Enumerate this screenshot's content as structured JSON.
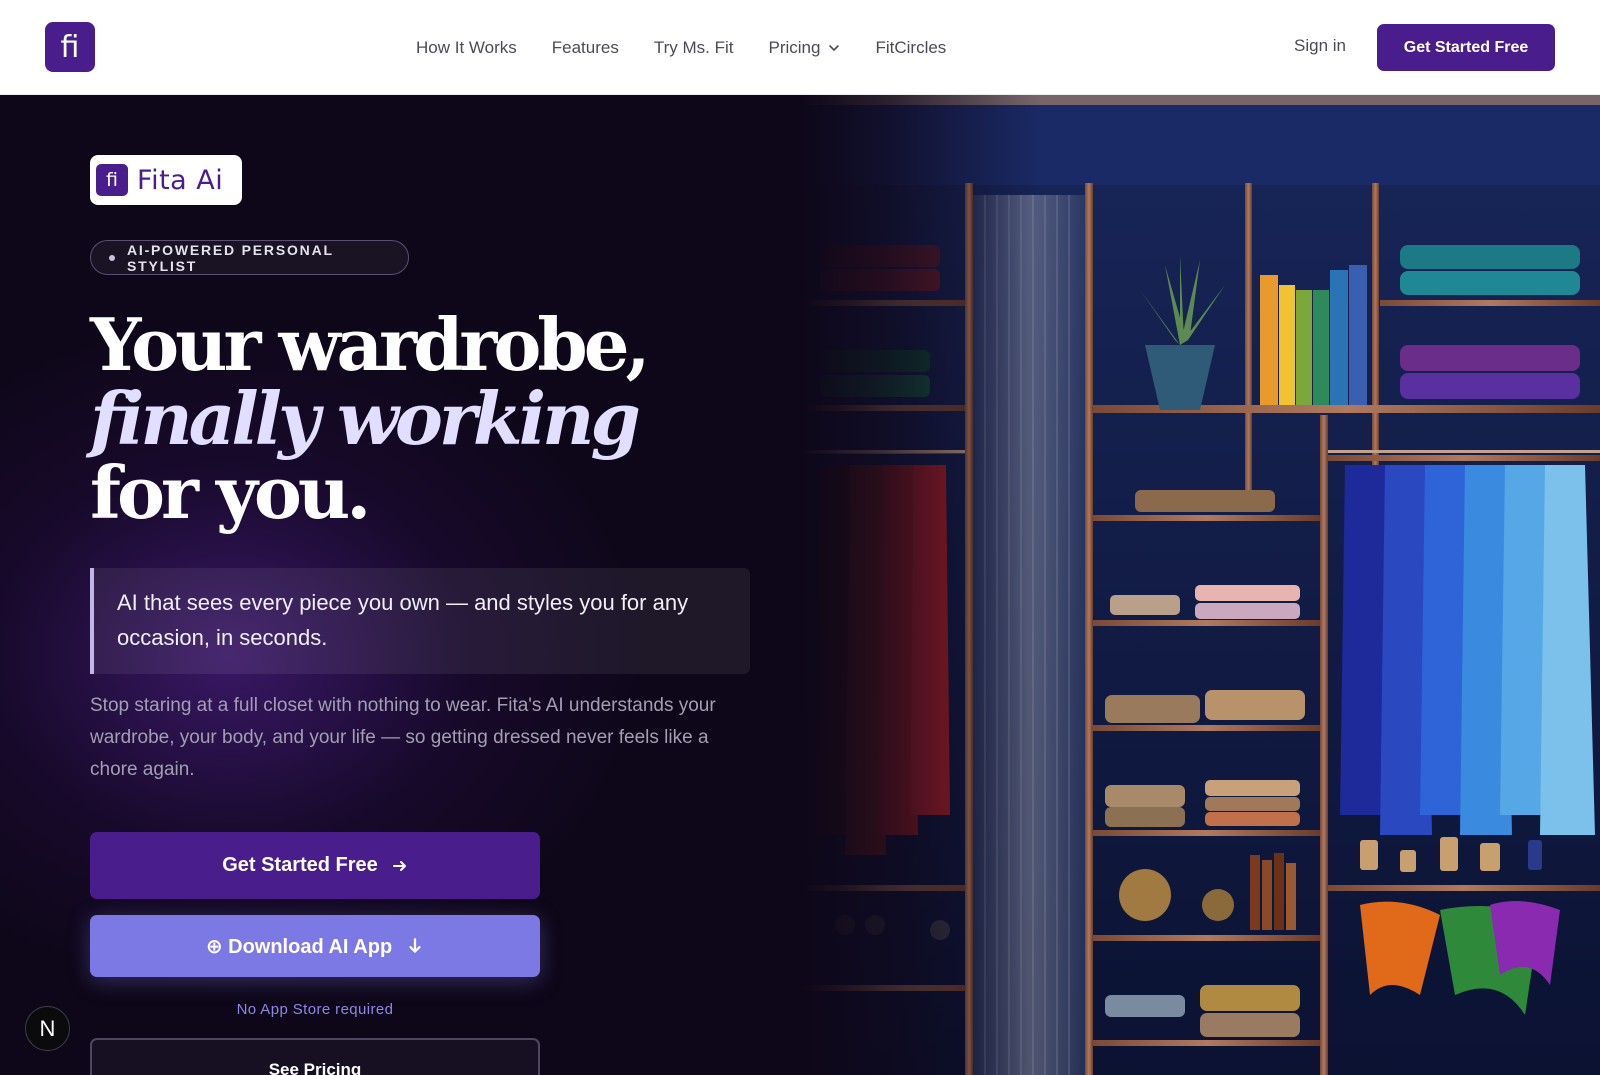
{
  "header": {
    "logo_glyph": "ﬁ",
    "nav": [
      {
        "label": "How It Works"
      },
      {
        "label": "Features"
      },
      {
        "label": "Try Ms. Fit"
      },
      {
        "label": "Pricing"
      },
      {
        "label": "FitCircles"
      }
    ],
    "signin_label": "Sign in",
    "cta_label": "Get Started Free"
  },
  "hero": {
    "brand_glyph": "ﬁ",
    "brand_name": "Fita Ai",
    "badge": "AI-POWERED PERSONAL STYLIST",
    "headline": {
      "line1": "Your wardrobe,",
      "line2": "finally working",
      "line3": "for you."
    },
    "quote": "AI that sees every piece you own — and styles you for any occasion, in seconds.",
    "paragraph": "Stop staring at a full closet with nothing to wear. Fita's AI understands your wardrobe, your body, and your life — so getting dressed never feels like a chore again.",
    "primary_cta": "Get Started Free",
    "download_cta": "⊕ Download AI App",
    "download_note": "No App Store required",
    "pricing_cta": "See Pricing"
  },
  "dev_badge": "N",
  "colors": {
    "brand": "#4a1d8c",
    "download": "#7c78e4",
    "hero_bg": "#0e0719",
    "note": "#8b86e8"
  },
  "icons": [
    "chevron-down-icon",
    "arrow-right-icon",
    "arrow-down-icon"
  ]
}
